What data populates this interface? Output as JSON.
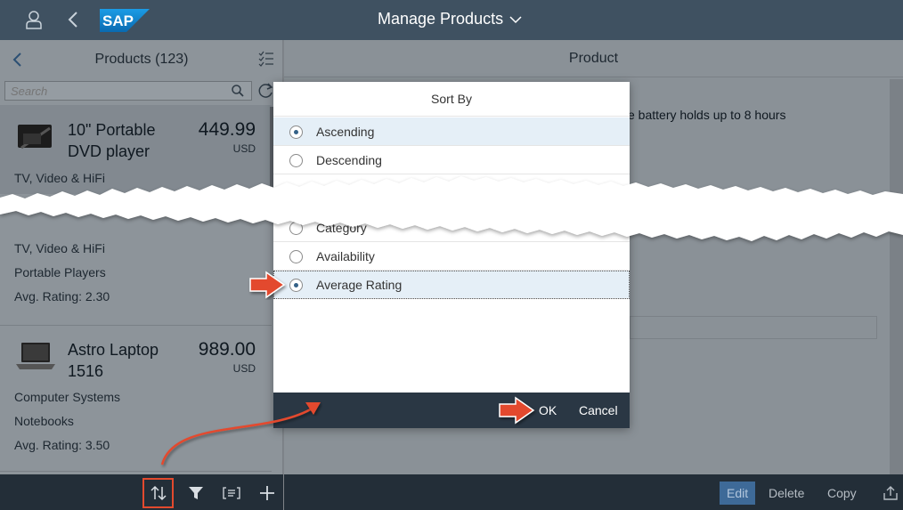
{
  "shell": {
    "app_title": "Manage Products",
    "logo_text": "SAP",
    "icons": {
      "user": "user-icon",
      "back": "back-icon",
      "title_menu": "chevron-down-icon"
    }
  },
  "master": {
    "title": "Products (123)",
    "search_placeholder": "Search",
    "items": [
      {
        "name": "10\" Portable DVD player",
        "price": "449.99",
        "currency": "USD",
        "category": "TV, Video & HiFi"
      },
      {
        "category": "TV, Video & HiFi",
        "subcategory": "Portable Players",
        "rating": "Avg. Rating: 2.30"
      },
      {
        "name": "Astro Laptop 1516",
        "price": "989.00",
        "currency": "USD",
        "category": "Computer Systems",
        "subcategory": "Notebooks",
        "rating": "Avg. Rating: 3.50"
      }
    ],
    "footer_icons": [
      "sort-icon",
      "filter-icon",
      "group-icon",
      "add-icon"
    ]
  },
  "detail": {
    "title": "Product",
    "description_fragment": "e battery holds up to 8 hours",
    "footer": {
      "edit": "Edit",
      "delete": "Delete",
      "copy": "Copy"
    }
  },
  "dialog": {
    "title": "Sort By",
    "order_options": [
      {
        "label": "Ascending",
        "selected": true
      },
      {
        "label": "Descending",
        "selected": false
      }
    ],
    "field_options": [
      {
        "label": "Category",
        "selected": false
      },
      {
        "label": "Availability",
        "selected": false
      },
      {
        "label": "Average Rating",
        "selected": true
      }
    ],
    "ok": "OK",
    "cancel": "Cancel"
  },
  "colors": {
    "shell": "#3f5161",
    "footer": "#232e38",
    "annotation_arrow": "#e34a2e",
    "selected_row": "#e5eff7",
    "radio_dot": "#346187"
  }
}
